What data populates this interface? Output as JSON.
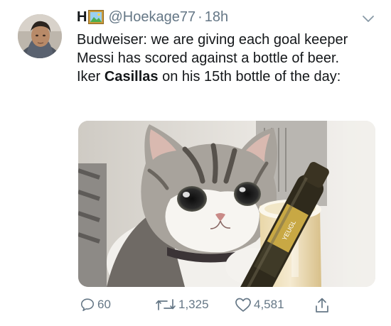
{
  "tweet": {
    "display_name": "H",
    "handle": "@Hoekage77",
    "separator": "·",
    "time": "18h",
    "line1": "Budweiser: we are giving each goal keeper Messi has scored against a bottle of beer.",
    "line2_before": "Iker ",
    "line2_bold": "Casillas",
    "line2_after": " on his 15th bottle of the day:"
  },
  "actions": {
    "reply_count": "60",
    "retweet_count": "1,325",
    "like_count": "4,581"
  },
  "media": {
    "bottle_label": "YEUGL"
  },
  "colors": {
    "text": "#14171a",
    "secondary": "#657786",
    "background": "#ffffff"
  },
  "icons": [
    "framed-picture-emoji-icon",
    "chevron-down-icon",
    "reply-icon",
    "retweet-icon",
    "like-icon",
    "share-icon"
  ]
}
